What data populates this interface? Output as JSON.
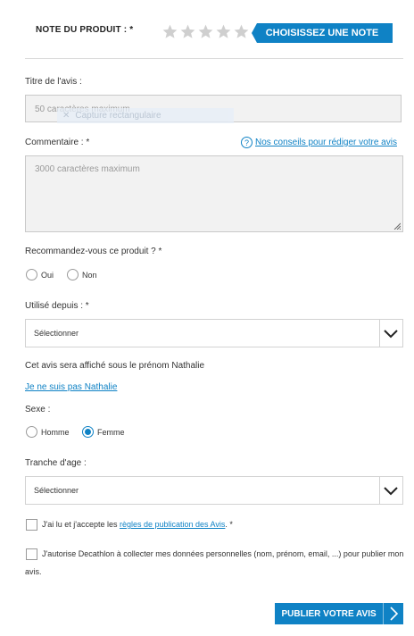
{
  "rating": {
    "label": "NOTE DU PRODUIT : *",
    "stars_total": 5,
    "stars_selected": 0,
    "button_label": "CHOISISSEZ UNE NOTE"
  },
  "title_field": {
    "label": "Titre de l'avis :",
    "placeholder": "50 caractères maximum"
  },
  "capture_overlay": {
    "label": "Capture rectangulaire"
  },
  "comment_field": {
    "label": "Commentaire : *",
    "placeholder": "3000 caractères maximum",
    "tips_link": "Nos conseils pour rédiger votre avis",
    "help_glyph": "?"
  },
  "recommend": {
    "label": "Recommandez-vous ce produit ? *",
    "options": [
      "Oui",
      "Non"
    ]
  },
  "used_since": {
    "label": "Utilisé depuis : *",
    "selected": "Sélectionner"
  },
  "display_name": {
    "text": "Cet avis sera affiché sous le prénom Nathalie",
    "not_me_link": "Je ne suis pas Nathalie"
  },
  "gender": {
    "label": "Sexe :",
    "options": [
      "Homme",
      "Femme"
    ],
    "selected": "Femme"
  },
  "age_range": {
    "label": "Tranche d'age :",
    "selected": "Sélectionner"
  },
  "consent": {
    "rules_prefix": "J'ai lu et j'accepte les ",
    "rules_link": "règles de publication des Avis",
    "rules_suffix": ". *",
    "data_text_line1": "J'autorise Decathlon à collecter mes données personnelles (nom, prénom, email, ...) pour publier mon",
    "data_text_line2": "avis."
  },
  "publish": {
    "label": "PUBLIER VOTRE AVIS"
  },
  "colors": {
    "accent": "#0f82c5",
    "field_bg": "#f2f2f2",
    "star_empty": "#cfcfcf"
  }
}
